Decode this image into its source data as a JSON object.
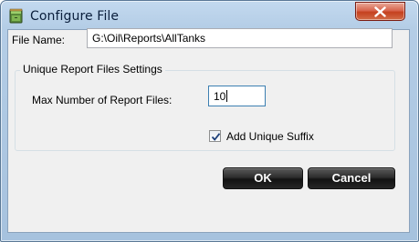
{
  "window": {
    "title": "Configure File",
    "title_icon": "file-cabinet-icon",
    "close_icon": "close-icon"
  },
  "file_name": {
    "label": "File Name:",
    "value": "G:\\Oil\\Reports\\AllTanks"
  },
  "group": {
    "legend": "Unique Report Files Settings",
    "max_label": "Max Number of Report Files:",
    "max_value": "10",
    "suffix_label": "Add Unique Suffix",
    "suffix_checked": true
  },
  "buttons": {
    "ok_label": "OK",
    "cancel_label": "Cancel"
  },
  "colors": {
    "title_bar": "#b4cde6",
    "close_button": "#c4401f",
    "dialog_bg": "#f0f0f0",
    "button_bg": "#1a1a1a",
    "button_text": "#ffffff"
  }
}
